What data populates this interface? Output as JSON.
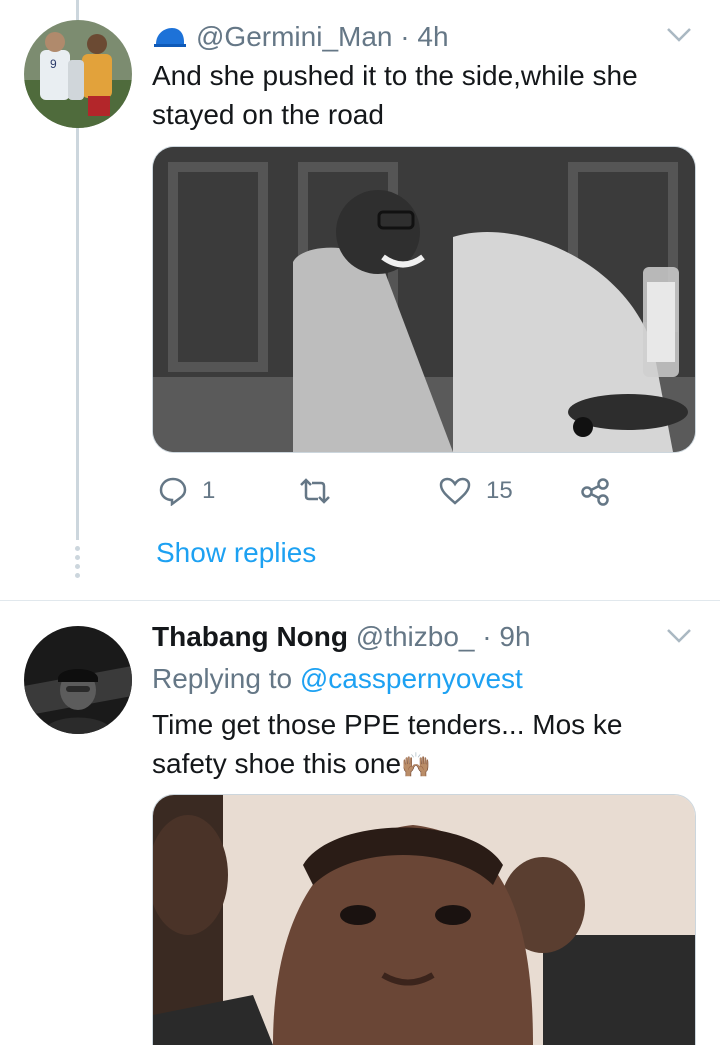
{
  "tweet1": {
    "handle": "@Germini_Man",
    "separator": "·",
    "time": "4h",
    "text": "And she pushed it to the side,while she stayed on the road",
    "reply_count": "1",
    "retweet_count": "",
    "like_count": "15",
    "show_replies": "Show replies"
  },
  "tweet2": {
    "name": "Thabang Nong",
    "handle": "@thizbo_",
    "separator": "·",
    "time": "9h",
    "replying_to_label": "Replying to",
    "replying_to_handle": "@casspernyovest",
    "text": "Time get those PPE tenders... Mos ke safety shoe this one",
    "emoji": "🙌🏽"
  },
  "colors": {
    "link": "#1da1f2",
    "muted": "#657786",
    "thread_line": "#ccd6dd",
    "divider": "#e1e8ed"
  },
  "icons": {
    "badge": "cap-icon",
    "reply": "reply-icon",
    "retweet": "retweet-icon",
    "like": "heart-icon",
    "share": "share-icon",
    "menu": "chevron-down-icon"
  }
}
